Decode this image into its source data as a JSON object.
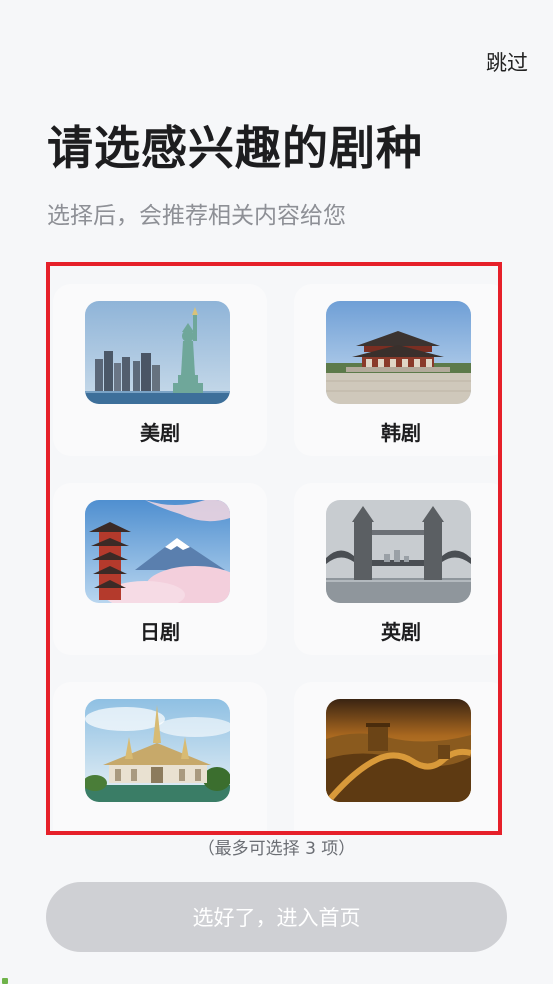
{
  "header": {
    "skip_label": "跳过",
    "title": "请选感兴趣的剧种",
    "subtitle": "选择后，会推荐相关内容给您"
  },
  "genres": [
    {
      "label": "美剧",
      "image": "statue-of-liberty"
    },
    {
      "label": "韩剧",
      "image": "korean-palace"
    },
    {
      "label": "日剧",
      "image": "mount-fuji-pagoda"
    },
    {
      "label": "英剧",
      "image": "tower-bridge"
    },
    {
      "label": "",
      "image": "thai-temple"
    },
    {
      "label": "",
      "image": "great-wall"
    }
  ],
  "footer": {
    "limit_note": "（最多可选择 3 项）",
    "confirm_label": "选好了，进入首页"
  },
  "colors": {
    "highlight_border": "#e6202a",
    "button_disabled": "#cfd0d4",
    "background": "#f6f7f9"
  }
}
